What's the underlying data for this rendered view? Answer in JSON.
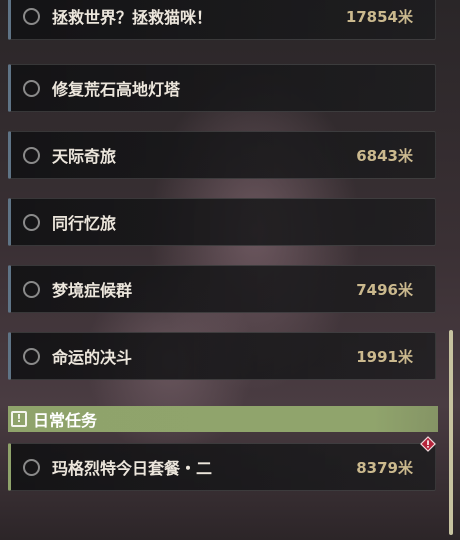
{
  "quests": [
    {
      "title": "拯救世界？拯救猫咪！",
      "distance": "17854米"
    },
    {
      "title": "修复荒石高地灯塔",
      "distance": ""
    },
    {
      "title": "天际奇旅",
      "distance": "6843米"
    },
    {
      "title": "同行忆旅",
      "distance": ""
    },
    {
      "title": "梦境症候群",
      "distance": "7496米"
    },
    {
      "title": "命运的决斗",
      "distance": "1991米"
    }
  ],
  "daily_section": {
    "icon": "exclamation-box-icon",
    "icon_glyph": "!",
    "label": "日常任务"
  },
  "daily_quests": [
    {
      "title": "玛格烈特今日套餐・二",
      "distance": "8379米"
    }
  ],
  "colors": {
    "accent_main": "#5f7486",
    "accent_daily": "#8fa36b",
    "distance_text": "#cbb98e",
    "alert_badge": "#b5233a"
  }
}
